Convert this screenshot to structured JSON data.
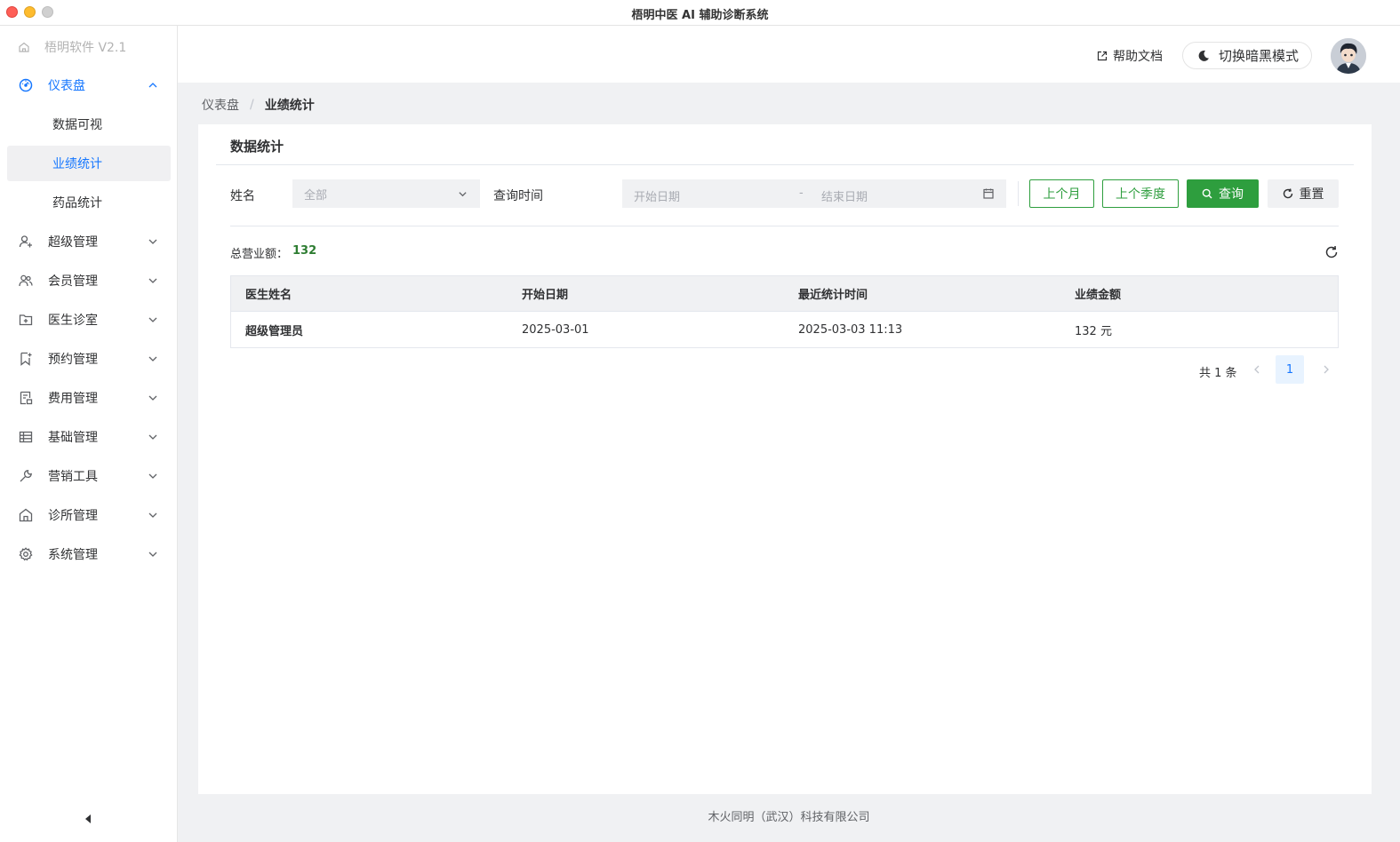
{
  "window": {
    "title": "梧明中医 AI 辅助诊断系统"
  },
  "sidebar": {
    "brand": "梧明软件 V2.1",
    "items": [
      {
        "label": "仪表盘",
        "icon": "dashboard-icon",
        "expanded": true,
        "children": [
          {
            "label": "数据可视"
          },
          {
            "label": "业绩统计",
            "selected": true
          },
          {
            "label": "药品统计"
          }
        ]
      },
      {
        "label": "超级管理",
        "icon": "user-add-icon"
      },
      {
        "label": "会员管理",
        "icon": "users-icon"
      },
      {
        "label": "医生诊室",
        "icon": "clinic-folder-icon"
      },
      {
        "label": "预约管理",
        "icon": "bookmark-icon"
      },
      {
        "label": "费用管理",
        "icon": "receipt-icon"
      },
      {
        "label": "基础管理",
        "icon": "table-icon"
      },
      {
        "label": "营销工具",
        "icon": "wrench-icon"
      },
      {
        "label": "诊所管理",
        "icon": "house-icon"
      },
      {
        "label": "系统管理",
        "icon": "gear-icon"
      }
    ]
  },
  "header": {
    "help_label": "帮助文档",
    "dark_mode_label": "切换暗黑模式"
  },
  "breadcrumb": {
    "root": "仪表盘",
    "separator": "/",
    "current": "业绩统计"
  },
  "card": {
    "title": "数据统计",
    "filters": {
      "name_label": "姓名",
      "name_value": "全部",
      "time_label": "查询时间",
      "start_placeholder": "开始日期",
      "range_separator": "-",
      "end_placeholder": "结束日期"
    },
    "buttons": {
      "last_month": "上个月",
      "last_quarter": "上个季度",
      "query": "查询",
      "reset": "重置"
    },
    "total_label": "总营业额：",
    "total_value": "132",
    "table": {
      "headers": [
        "医生姓名",
        "开始日期",
        "最近统计时间",
        "业绩金额"
      ],
      "rows": [
        [
          "超级管理员",
          "2025-03-01",
          "2025-03-03 11:13",
          "132 元"
        ]
      ]
    },
    "pagination": {
      "total": "共 1 条",
      "current_page": "1"
    }
  },
  "footer": {
    "text": "木火同明（武汉）科技有限公司"
  },
  "colors": {
    "accent": "#1677ff",
    "primary_green": "#2e9e3e",
    "total_green": "#2e7d32"
  }
}
